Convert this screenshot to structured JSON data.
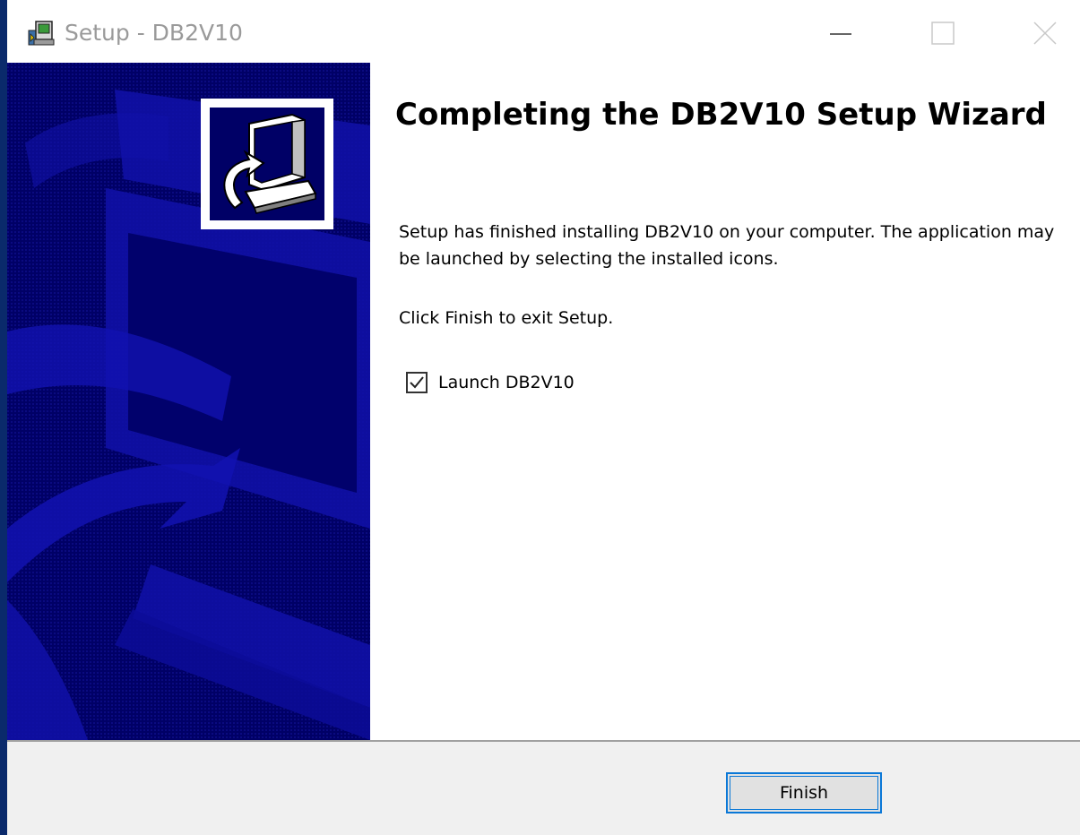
{
  "window": {
    "title": "Setup - DB2V10",
    "app_icon": "setup-installer-icon",
    "controls": {
      "minimize_icon": "minimize-icon",
      "maximize_icon": "maximize-icon",
      "close_icon": "close-icon"
    }
  },
  "banner": {
    "logo_icon": "computer-install-icon",
    "background_color": "#000066",
    "pattern_color": "#1010a8"
  },
  "content": {
    "heading": "Completing the DB2V10 Setup Wizard",
    "paragraph1": "Setup has finished installing DB2V10 on your computer. The application may be launched by selecting the installed icons.",
    "paragraph2": "Click Finish to exit Setup.",
    "launch_checkbox": {
      "label": "Launch DB2V10",
      "checked": true
    }
  },
  "footer": {
    "finish_label": "Finish",
    "accent_color": "#0a78d7"
  }
}
